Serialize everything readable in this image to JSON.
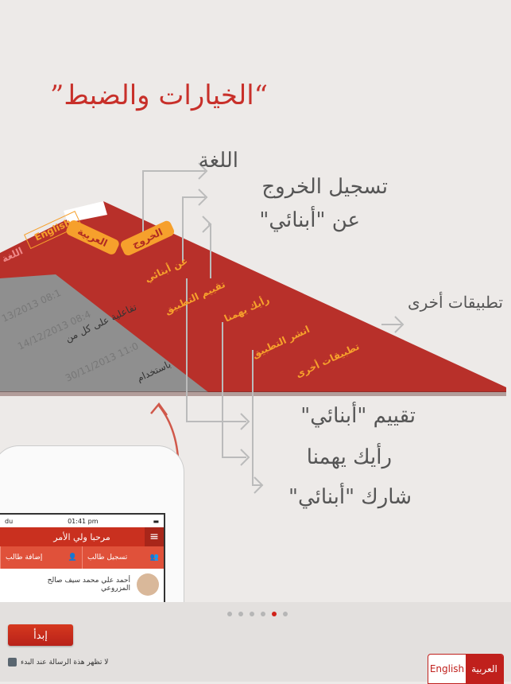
{
  "title": "“الخيارات والضبط”",
  "callouts": {
    "language": "اللغة",
    "logout": "تسجيل الخروج",
    "about": "عن \"أبنائي\"",
    "other_apps": "تطبيقات أخرى",
    "rate": "تقييم \"أبنائي\"",
    "feedback": "رأيك يهمنا",
    "share": "شارك \"أبنائي\""
  },
  "menu_panel": {
    "lang_label": "اللغة",
    "arabic": "العربية",
    "english": "English",
    "logout": "الخروج",
    "about": "عن أبنائي",
    "rate": "تقييم التطبيق",
    "feedback": "رأيك يهمنا",
    "share": "انشر التطبيق",
    "other_apps": "تطبيقات أخرى",
    "list_dates": [
      "13/2013 08:1",
      "14/12/2013 08:4",
      "30/11/2013 11:0"
    ],
    "list_texts": [
      "تفاعلية على كل من",
      "باستخدام"
    ]
  },
  "phone": {
    "carrier": "du",
    "time": "01:41 pm",
    "header": "مرحبا ولي الأمر",
    "add_student": "إضافة طالب",
    "register_student": "تسجيل طالب",
    "student_name": "أحمد علي محمد سيف صالح المزروعي"
  },
  "pager": {
    "count": 6,
    "active": 5
  },
  "start_button": "إبدأ",
  "dont_show": "لا تظهر هذة الرسالة عند البدء",
  "language_toggle": {
    "arabic": "العربية",
    "english": "English",
    "selected": "العربية"
  },
  "colors": {
    "accent": "#c0201c",
    "panel": "#b8302a",
    "panel_text": "#f6a02c"
  }
}
